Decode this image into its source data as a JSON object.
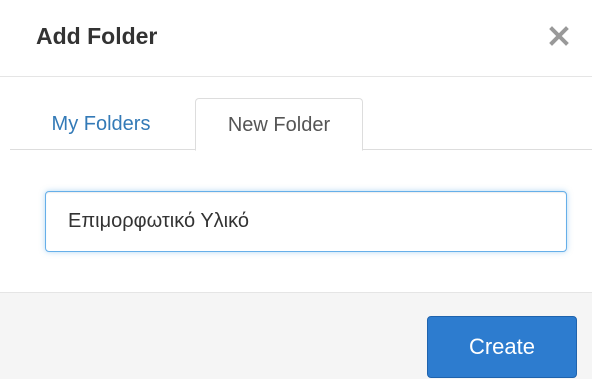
{
  "dialog": {
    "title": "Add Folder",
    "close_icon": "close-icon"
  },
  "tabs": [
    {
      "label": "My Folders",
      "active": false
    },
    {
      "label": "New Folder",
      "active": true
    }
  ],
  "folder_input": {
    "value": "Επιμορφωτικό Υλικό"
  },
  "footer": {
    "create_label": "Create"
  },
  "colors": {
    "accent": "#2d7ccf",
    "link": "#337ab7",
    "title": "#333333",
    "close": "#999999"
  }
}
